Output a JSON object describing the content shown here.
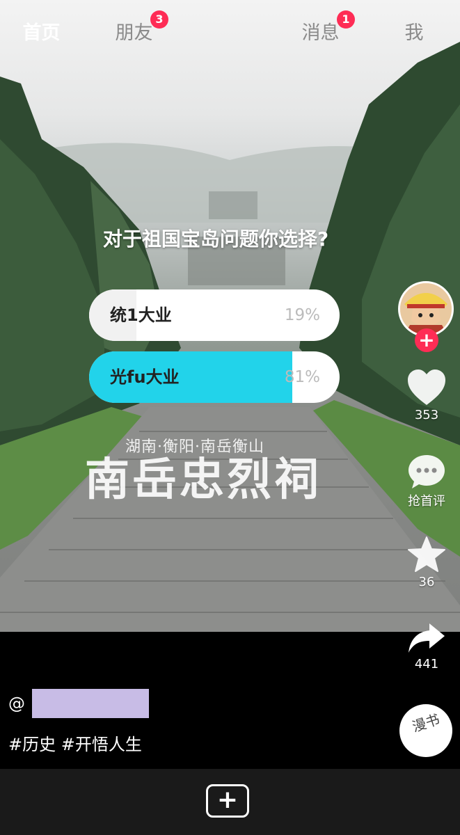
{
  "poll": {
    "question": "对于祖国宝岛问题你选择?",
    "options": [
      {
        "label": "统1大业",
        "percent": "19%",
        "fraction": 0.19
      },
      {
        "label": "光fu大业",
        "percent": "81%",
        "fraction": 0.81
      }
    ]
  },
  "overlay": {
    "location": "湖南·衡阳·南岳衡山",
    "title": "南岳忠烈祠"
  },
  "actions": {
    "likes": "353",
    "comments": "抢首评",
    "favorites": "36",
    "shares": "441"
  },
  "caption": {
    "at_sign": "@",
    "hashtags": "#历史 #开悟人生"
  },
  "music_disc": "漫书",
  "nav": {
    "home": "首页",
    "friends": "朋友",
    "friends_badge": "3",
    "add": "+",
    "messages": "消息",
    "messages_badge": "1",
    "me": "我"
  },
  "colors": {
    "accent_red": "#fe2c55",
    "poll_fill": "#22d3ea",
    "redaction": "#c8bce6"
  }
}
